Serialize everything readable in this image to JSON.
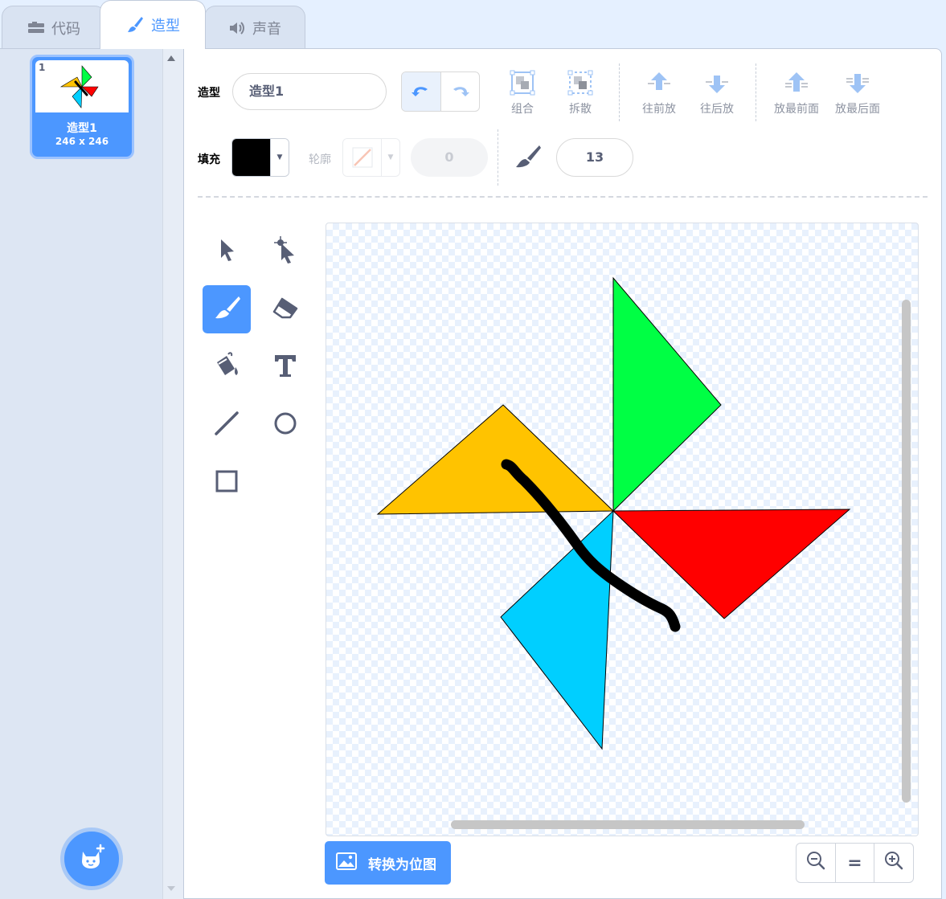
{
  "tabs": {
    "code": "代码",
    "costume": "造型",
    "sound": "声音"
  },
  "costume_list": [
    {
      "number": "1",
      "name": "造型1",
      "size": "246 x 246"
    }
  ],
  "toolbar": {
    "costume_label": "造型",
    "costume_name": "造型1",
    "group": "组合",
    "ungroup": "拆散",
    "forward": "往前放",
    "backward": "往后放",
    "front": "放最前面",
    "back": "放最后面",
    "fill_label": "填充",
    "fill_color": "#000000",
    "outline_label": "轮廓",
    "outline_width": "0",
    "brush_size": "13"
  },
  "tools": [
    "select",
    "reshape",
    "brush",
    "eraser",
    "fill",
    "text",
    "line",
    "circle",
    "rectangle"
  ],
  "active_tool": "brush",
  "canvas": {
    "shapes": [
      {
        "name": "green-triangle",
        "color": "#00ff44"
      },
      {
        "name": "yellow-triangle",
        "color": "#ffc300"
      },
      {
        "name": "red-triangle",
        "color": "#ff0000"
      },
      {
        "name": "blue-triangle",
        "color": "#00cfff"
      },
      {
        "name": "black-brush-stroke",
        "color": "#000000"
      }
    ]
  },
  "bottom": {
    "convert_bitmap": "转换为位图",
    "zoom_reset": "="
  },
  "colors": {
    "accent": "#4c97ff"
  }
}
